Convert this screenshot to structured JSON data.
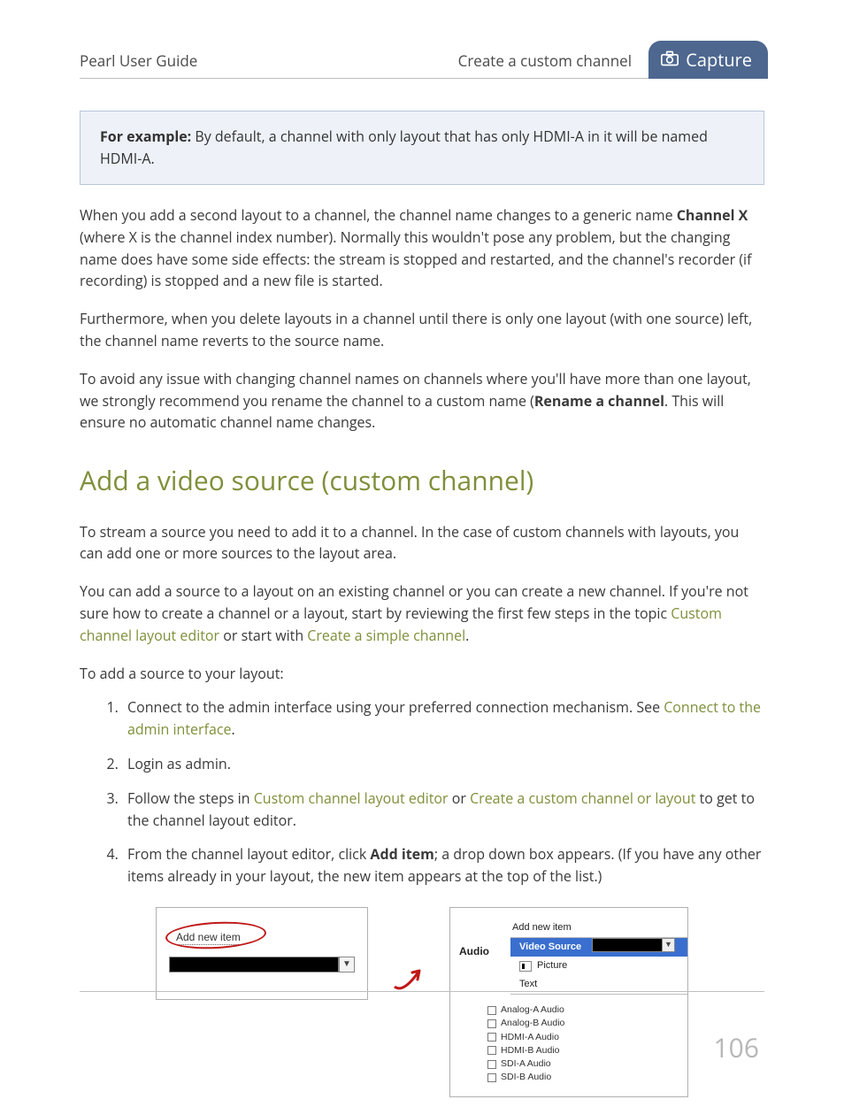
{
  "header": {
    "guide_title": "Pearl User Guide",
    "breadcrumb": "Create a custom channel",
    "tab_label": "Capture"
  },
  "note": {
    "lead": "For example:",
    "text": " By default, a channel with only layout that has only HDMI-A in it will be named HDMI-A."
  },
  "paragraphs": {
    "p1a": "When you add a second layout to a channel, the channel name changes to a generic name ",
    "p1b": "Channel X",
    "p1c": " (where X is the channel index number). Normally this wouldn't pose any problem, but the changing name does have some side effects: the stream is stopped and restarted, and the channel's recorder (if recording) is stopped and a new file is started.",
    "p2": "Furthermore, when you delete layouts in a channel until there is only one layout (with one source) left, the channel name reverts to the source name.",
    "p3a": "To avoid any issue with changing channel names on channels where you'll have more than one layout, we strongly recommend you rename the channel to a custom name (",
    "p3b": "Rename a channel",
    "p3c": ". This will ensure no automatic channel name changes."
  },
  "section_heading": "Add a video source (custom channel)",
  "section": {
    "intro1": "To stream a source you need to add it to a channel. In the case of custom channels with layouts, you can add one or more sources to the layout area.",
    "intro2a": "You can add a source to a layout on an existing channel or you can create a new channel. If you're not sure how to create a channel or a layout, start by reviewing the first few steps in the topic ",
    "link1": "Custom channel layout editor",
    "intro2b": " or start with ",
    "link2": "Create a simple channel",
    "intro2c": ".",
    "lead": "To add a source to your layout:"
  },
  "steps": {
    "s1a": "Connect to the admin interface using your preferred connection mechanism. See ",
    "s1link": "Connect to the admin interface",
    "s1b": ".",
    "s2": "Login as admin.",
    "s3a": "Follow the steps in ",
    "s3link1": "Custom channel layout editor",
    "s3b": " or ",
    "s3link2": "Create a custom channel or layout",
    "s3c": " to get to the channel layout editor.",
    "s4a": "From the channel layout editor, click ",
    "s4b": "Add item",
    "s4c": "; a drop down box appears. (If you have any other items already in your layout, the new item appears at the top of the list.)"
  },
  "figure": {
    "left_label": "Add new item",
    "right_header": "Add new item",
    "menu": {
      "video": "Video Source",
      "picture": "Picture",
      "text": "Text"
    },
    "audio_label": "Audio",
    "audio_items": [
      "Analog-A Audio",
      "Analog-B Audio",
      "HDMI-A Audio",
      "HDMI-B Audio",
      "SDI-A Audio",
      "SDI-B Audio"
    ]
  },
  "page_number": "106"
}
